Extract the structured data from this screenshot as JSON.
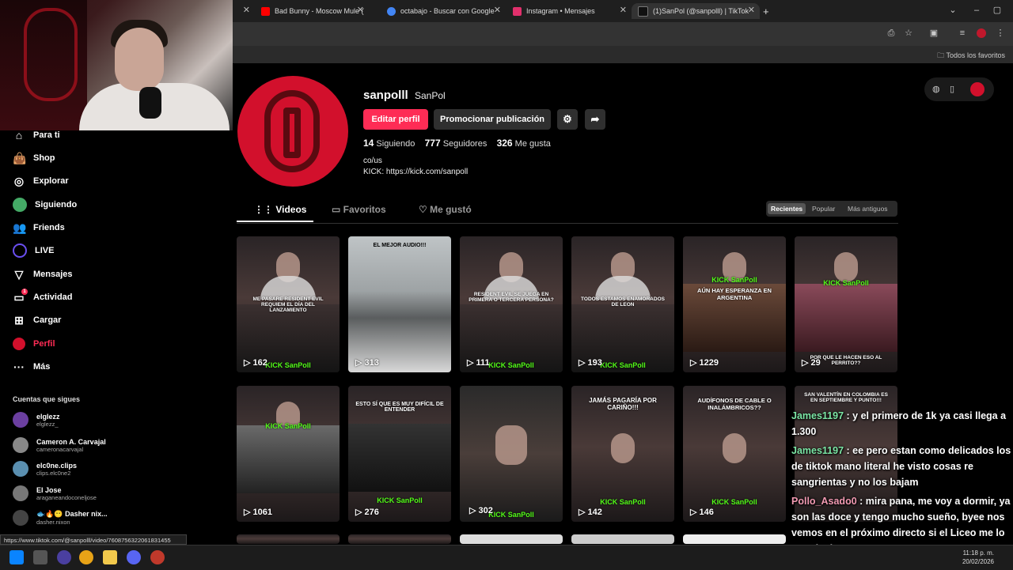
{
  "browser": {
    "tabs": [
      {
        "title": "Bad Bunny - Moscow Mule (Vid",
        "color": "#ff0000"
      },
      {
        "title": "octabajo - Buscar con Google",
        "color": "#4285f4"
      },
      {
        "title": "Instagram • Mensajes",
        "color": "#e1306c"
      },
      {
        "title": "(1)SanPol (@sanpolll) | TikTok",
        "color": "#111111"
      }
    ],
    "bookmarks_label": "Todos los favoritos"
  },
  "sidebar": {
    "items": [
      {
        "label": "Para ti",
        "icon": "home-icon"
      },
      {
        "label": "Shop",
        "icon": "bag-icon"
      },
      {
        "label": "Explorar",
        "icon": "compass-icon"
      },
      {
        "label": "Siguiendo",
        "icon": "following-icon"
      },
      {
        "label": "Friends",
        "icon": "friends-icon"
      },
      {
        "label": "LIVE",
        "icon": "live-icon"
      },
      {
        "label": "Mensajes",
        "icon": "send-icon"
      },
      {
        "label": "Actividad",
        "icon": "activity-icon",
        "badge": "1"
      },
      {
        "label": "Cargar",
        "icon": "upload-icon"
      },
      {
        "label": "Perfil",
        "icon": "profile-icon"
      },
      {
        "label": "Más",
        "icon": "more-icon"
      }
    ],
    "following_title": "Cuentas que sigues",
    "following": [
      {
        "name": "elglezz",
        "handle": "elglezz_",
        "color": "#6b3fa0"
      },
      {
        "name": "Cameron A. Carvajal",
        "handle": "cameronacarvajal",
        "color": "#888888"
      },
      {
        "name": "elc0ne.clips",
        "handle": "clips.elc0ne2",
        "color": "#5a8fb0"
      },
      {
        "name": "El Jose",
        "handle": "araganeandoconeljose",
        "color": "#777777"
      },
      {
        "name": "🐟🔥😶 Dasher nix...",
        "handle": "dasher.nixon",
        "color": "#444444"
      }
    ]
  },
  "status_url": "https://www.tiktok.com/@sanpolll/video/7608756322061831455",
  "profile": {
    "username": "sanpolll",
    "display_name": "SanPol",
    "edit_label": "Editar perfil",
    "promote_label": "Promocionar publicación",
    "following_count": "14",
    "following_label": "Siguiendo",
    "followers_count": "777",
    "followers_label": "Seguidores",
    "likes_count": "326",
    "likes_label": "Me gusta",
    "bio_line1": "co/us",
    "bio_line2": "KICK: https://kick.com/sanpoll"
  },
  "tabs": {
    "videos": "Videos",
    "favorites": "Favoritos",
    "liked": "Me gustó"
  },
  "sort": {
    "recent": "Recientes",
    "popular": "Popular",
    "oldest": "Más antiguos"
  },
  "videos": [
    {
      "views": "162",
      "caption": "Me pasare Resident Evil Requiem el día del lanzamiento",
      "kick": "KICK SanPoll"
    },
    {
      "views": "313",
      "caption": "El mejor audio!!!",
      "kick": ""
    },
    {
      "views": "111",
      "caption": "Resident Evil se juega en primera o tercera persona?",
      "kick": "KICK SanPoll"
    },
    {
      "views": "193",
      "caption": "Todos estamos enamorados de Leon",
      "kick": "KICK SanPoll"
    },
    {
      "views": "1229",
      "caption": "Aún hay esperanza en Argentina",
      "kick": "KICK SanPoll"
    },
    {
      "views": "29",
      "caption": "Por que le hacen eso al perrito??",
      "kick": "KICK SanPoll"
    },
    {
      "views": "1061",
      "caption": "",
      "kick": "KICK SanPoll"
    },
    {
      "views": "276",
      "caption": "Esto sí que es muy difícil de entender",
      "kick": "KICK SanPoll"
    },
    {
      "views": "302",
      "caption": "",
      "kick": "KICK SanPoll"
    },
    {
      "views": "142",
      "caption": "Jamás pagaría por cariño!!!",
      "kick": "KICK SanPoll"
    },
    {
      "views": "146",
      "caption": "Audífonos de cable o inalámbricos??",
      "kick": "KICK SanPoll"
    },
    {
      "views": "",
      "caption": "San Valentín en Colombia es en septiembre y punto!!!",
      "kick": ""
    }
  ],
  "chat": [
    {
      "user": "James1197",
      "text": ": y el primero de 1k ya casi llega a 1.300"
    },
    {
      "user": "James1197",
      "text": ": ee pero estan como delicados los de tiktok mano literal he visto cosas re sangrientas y no los bajam"
    },
    {
      "user": "Pollo_Asado0",
      "text": ": mira pana, me voy a dormir, ya son las doce y tengo mucho sueño, byee nos vemos en el próximo directo si el Liceo me lo permite:)"
    }
  ],
  "taskbar": {
    "time": "11:18 p. m.",
    "date": "20/02/2026"
  }
}
